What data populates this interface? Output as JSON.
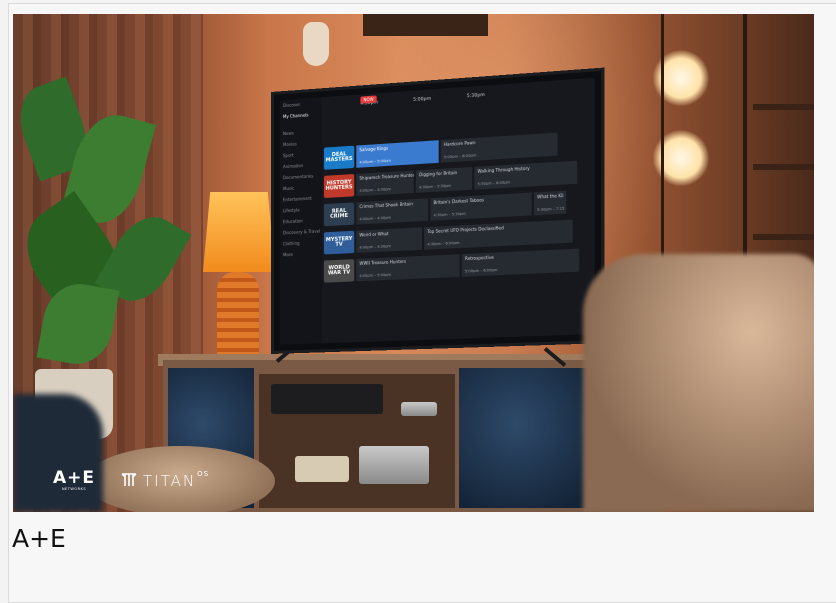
{
  "caption": "A+E",
  "logos": {
    "ae_main": "A+E",
    "ae_sub": "NETWORKS",
    "titan_word": "TITAN",
    "titan_sup": "OS"
  },
  "tv_guide": {
    "now_badge": "NOW",
    "times": [
      "4:30pm",
      "5:00pm",
      "5:30pm"
    ],
    "menu": [
      "Discover",
      "My Channels",
      "",
      "News",
      "Movies",
      "Sport",
      "Animation",
      "Documentaries",
      "Music",
      "Entertainment",
      "Lifestyle",
      "Education",
      "Discovery & Travel",
      "Clothing",
      "More"
    ],
    "menu_active_index": 1,
    "rows": [
      {
        "logo": "DEAL MASTERS",
        "logo_color": "#1a7bc9",
        "cells": [
          {
            "title": "Salvage Kings",
            "time": "4:00pm – 5:00pm",
            "selected": true
          },
          {
            "title": "Hardcore Pawn",
            "time": "5:00pm – 6:00pm",
            "selected": false
          }
        ]
      },
      {
        "logo": "HISTORY HUNTERS",
        "logo_color": "#c0392b",
        "cells": [
          {
            "title": "Shipwreck Treasure Hunter",
            "time": "4:00pm – 4:30pm",
            "selected": false
          },
          {
            "title": "Digging for Britain",
            "time": "4:30pm – 5:30pm",
            "selected": false
          },
          {
            "title": "Walking Through History",
            "time": "5:30pm – 6:00pm",
            "selected": false
          }
        ]
      },
      {
        "logo": "REAL CRIME",
        "logo_color": "#2c3e50",
        "cells": [
          {
            "title": "Crimes That Shook Britain",
            "time": "4:00pm – 4:30pm",
            "selected": false
          },
          {
            "title": "Britain's Darkest Taboos",
            "time": "4:30pm – 5:30pm",
            "selected": false
          },
          {
            "title": "What the Kil",
            "time": "5:30pm – 7:15",
            "selected": false
          }
        ]
      },
      {
        "logo": "MYSTERY TV",
        "logo_color": "#2f5e9a",
        "cells": [
          {
            "title": "Weird or What",
            "time": "4:00pm – 4:30pm",
            "selected": false
          },
          {
            "title": "Top Secret UFO Projects Declassified",
            "time": "4:30pm – 6:00pm",
            "selected": false
          }
        ]
      },
      {
        "logo": "WORLD WAR TV",
        "logo_color": "#4a4a4a",
        "cells": [
          {
            "title": "WWII Treasure Hunters",
            "time": "4:00pm – 5:00pm",
            "selected": false
          },
          {
            "title": "Retrospective",
            "time": "5:00pm – 6:00pm",
            "selected": false
          }
        ]
      }
    ]
  }
}
